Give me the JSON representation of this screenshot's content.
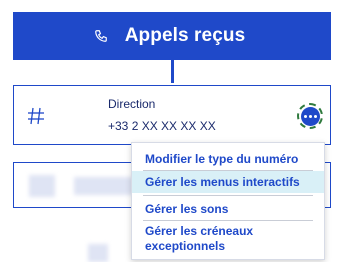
{
  "header": {
    "icon": "phone-icon",
    "title": "Appels reçus"
  },
  "card": {
    "icon": "hash-icon",
    "title": "Direction",
    "number": "+33 2 XX XX XX XX",
    "more_button_icon": "more-horizontal-icon"
  },
  "menu": {
    "items": [
      {
        "label": "Modifier le type du numéro"
      },
      {
        "label": "Gérer les menus interactifs",
        "highlighted": true
      },
      {
        "label": "Gérer les sons"
      },
      {
        "label_line1": "Gérer les créneaux",
        "label_line2": "exceptionnels"
      }
    ]
  },
  "colors": {
    "brand": "#1f49c9",
    "menu_highlight": "#d9f0f7",
    "focus_ring": "#2f7a3d"
  }
}
